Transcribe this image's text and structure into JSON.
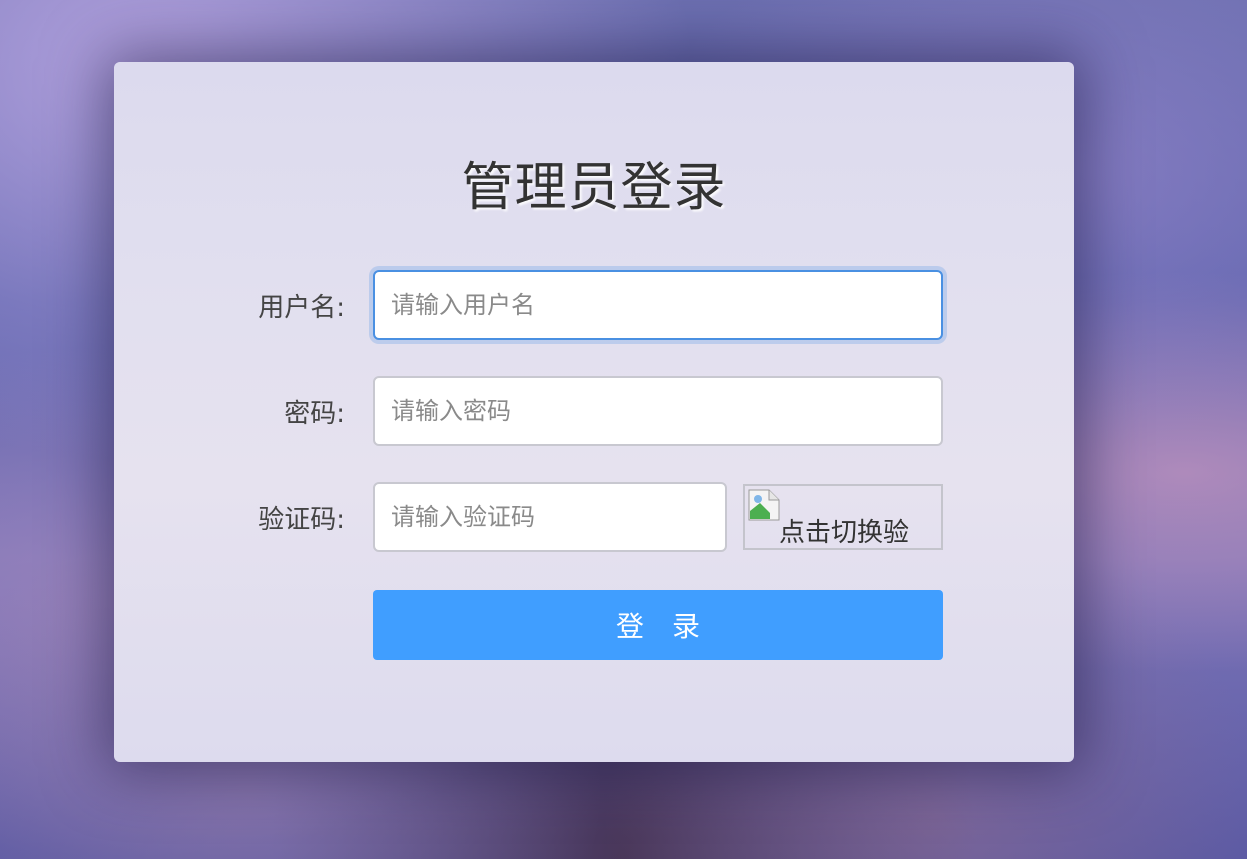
{
  "login": {
    "title": "管理员登录",
    "username": {
      "label": "用户名:",
      "placeholder": "请输入用户名",
      "value": ""
    },
    "password": {
      "label": "密码:",
      "placeholder": "请输入密码",
      "value": ""
    },
    "captcha": {
      "label": "验证码:",
      "placeholder": "请输入验证码",
      "value": "",
      "image_alt": "点击切换验"
    },
    "submit_label": "登录"
  },
  "colors": {
    "primary": "#409eff",
    "focus_border": "#4a90e2"
  }
}
